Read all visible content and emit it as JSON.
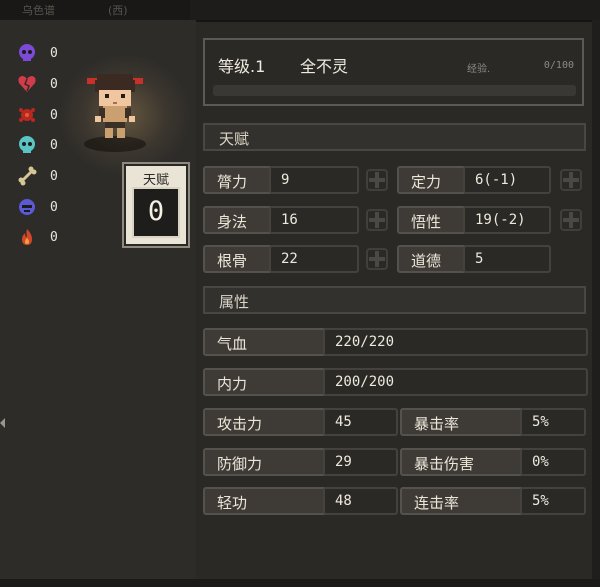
{
  "topbar": {
    "left_text": "乌色谱",
    "right_text": "(西)"
  },
  "status_effects": [
    {
      "icon": "purple-skull-icon",
      "color": "#7b4ad6",
      "value": "0"
    },
    {
      "icon": "broken-heart-icon",
      "color": "#d23c4a",
      "value": "0"
    },
    {
      "icon": "red-blot-icon",
      "color": "#b8281e",
      "value": "0"
    },
    {
      "icon": "cyan-skull-icon",
      "color": "#5ac4c4",
      "value": "0"
    },
    {
      "icon": "bone-icon",
      "color": "#d6c596",
      "value": "0"
    },
    {
      "icon": "blue-face-icon",
      "color": "#5a5ad6",
      "value": "0"
    },
    {
      "icon": "flame-icon",
      "color": "#d2482a",
      "value": "0"
    }
  ],
  "talent": {
    "label": "天赋",
    "points": "0"
  },
  "level": {
    "title": "等级.1",
    "name": "全不灵",
    "exp_label": "经验.",
    "exp_value": "0/100",
    "exp_progress": 0.0
  },
  "sections": {
    "talent": "天赋",
    "attributes": "属性"
  },
  "talent_stats": [
    {
      "label": "膂力",
      "value": "9"
    },
    {
      "label": "定力",
      "value": "6(-1)"
    },
    {
      "label": "身法",
      "value": "16"
    },
    {
      "label": "悟性",
      "value": "19(-2)"
    },
    {
      "label": "根骨",
      "value": "22"
    },
    {
      "label": "道德",
      "value": "5"
    }
  ],
  "attributes": {
    "hp_label": "气血",
    "hp_value": "220/220",
    "mp_label": "内力",
    "mp_value": "200/200",
    "atk_label": "攻击力",
    "atk_value": "45",
    "crit_label": "暴击率",
    "crit_value": "5%",
    "def_label": "防御力",
    "def_value": "29",
    "critdmg_label": "暴击伤害",
    "critdmg_value": "0%",
    "agi_label": "轻功",
    "agi_value": "48",
    "combo_label": "连击率",
    "combo_value": "5%"
  },
  "colors": {
    "accent": "#b9a062",
    "panel_border": "#5d5a55",
    "background": "#2b2926"
  }
}
